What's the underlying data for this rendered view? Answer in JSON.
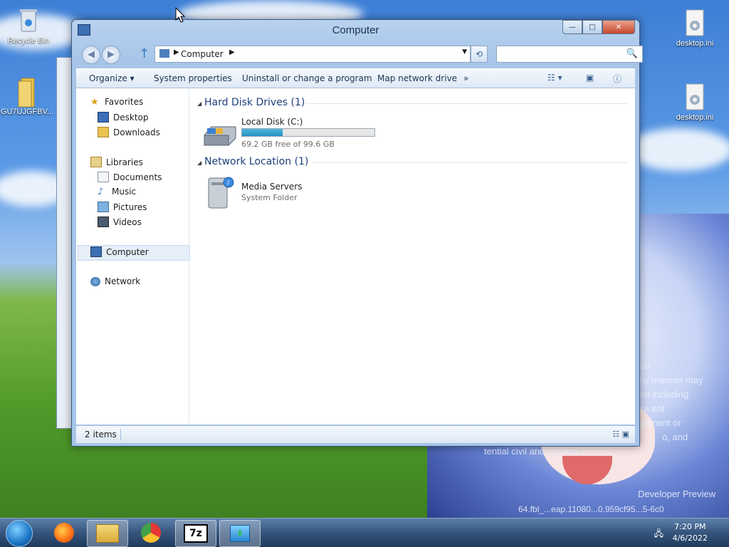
{
  "desktop": {
    "icons": [
      {
        "label": "Recycle Bin",
        "icon": "recycle-bin-icon"
      },
      {
        "label": "GU7UJGFBV...",
        "icon": "folder-icon"
      },
      {
        "label": "desktop.ini",
        "icon": "settings-file-icon"
      },
      {
        "label": "desktop.ini",
        "icon": "settings-file-icon"
      }
    ],
    "watermark_lines": [
      "ial",
      "ny manner may",
      "nd including",
      "ca ent",
      "gnment or",
      "o, and",
      "tential civil and criminal li",
      "Developer Preview",
      "64.fbl_...eap.11080...0.959cf95...5-6c0"
    ]
  },
  "window": {
    "title": "Computer",
    "controls": {
      "minimize": "—",
      "maximize": "□",
      "close": "✕"
    },
    "nav": {
      "back": "◀",
      "forward": "▶",
      "up": "↑",
      "breadcrumb": "Computer",
      "refresh": "⟲",
      "search_placeholder": "",
      "search_icon": "🔍"
    },
    "commands": [
      {
        "label": "Organize ▾",
        "name": "organize-menu"
      },
      {
        "label": "System properties",
        "name": "system-properties-button"
      },
      {
        "label": "Uninstall or change a program",
        "name": "uninstall-program-button"
      },
      {
        "label": "Map network drive",
        "name": "map-network-drive-button"
      },
      {
        "label": "»",
        "name": "more-commands-button"
      }
    ],
    "sidebar": {
      "favorites": {
        "label": "Favorites",
        "items": [
          {
            "label": "Desktop"
          },
          {
            "label": "Downloads"
          }
        ]
      },
      "libraries": {
        "label": "Libraries",
        "items": [
          {
            "label": "Documents"
          },
          {
            "label": "Music"
          },
          {
            "label": "Pictures"
          },
          {
            "label": "Videos"
          }
        ]
      },
      "computer": {
        "label": "Computer"
      },
      "network": {
        "label": "Network"
      }
    },
    "groups": {
      "hard_disks": {
        "header": "Hard Disk Drives (1)",
        "items": [
          {
            "name": "Local Disk (C:)",
            "free_text": "69.2 GB free of 99.6 GB",
            "used_fraction": 0.305
          }
        ]
      },
      "network": {
        "header": "Network Location (1)",
        "items": [
          {
            "name": "Media Servers",
            "type": "System Folder"
          }
        ]
      }
    },
    "status": {
      "count": "2 items"
    }
  },
  "taskbar": {
    "items": [
      {
        "name": "firefox",
        "icon": "firefox-icon"
      },
      {
        "name": "explorer",
        "icon": "explorer-icon",
        "active": true
      },
      {
        "name": "chrome",
        "icon": "chrome-icon"
      },
      {
        "name": "7zip",
        "icon": "7zip-icon",
        "label": "7z"
      },
      {
        "name": "extract",
        "icon": "extract-icon"
      }
    ],
    "clock": {
      "time": "7:20 PM",
      "date": "4/6/2022"
    }
  },
  "colors": {
    "accent": "#1e3f7a",
    "bar_fill": "#2590c4",
    "taskbar": "#36557d"
  }
}
